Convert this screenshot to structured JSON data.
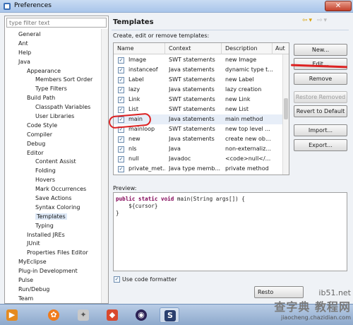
{
  "window": {
    "title": "Preferences"
  },
  "filter": {
    "placeholder": "type filter text"
  },
  "tree": [
    {
      "label": "General",
      "level": 0
    },
    {
      "label": "Ant",
      "level": 0
    },
    {
      "label": "Help",
      "level": 0
    },
    {
      "label": "Java",
      "level": 0
    },
    {
      "label": "Appearance",
      "level": 1
    },
    {
      "label": "Members Sort Order",
      "level": 2
    },
    {
      "label": "Type Filters",
      "level": 2
    },
    {
      "label": "Build Path",
      "level": 1
    },
    {
      "label": "Classpath Variables",
      "level": 2
    },
    {
      "label": "User Libraries",
      "level": 2
    },
    {
      "label": "Code Style",
      "level": 1
    },
    {
      "label": "Compiler",
      "level": 1
    },
    {
      "label": "Debug",
      "level": 1
    },
    {
      "label": "Editor",
      "level": 1
    },
    {
      "label": "Content Assist",
      "level": 2
    },
    {
      "label": "Folding",
      "level": 2
    },
    {
      "label": "Hovers",
      "level": 2
    },
    {
      "label": "Mark Occurrences",
      "level": 2
    },
    {
      "label": "Save Actions",
      "level": 2
    },
    {
      "label": "Syntax Coloring",
      "level": 2
    },
    {
      "label": "Templates",
      "level": 2,
      "selected": true
    },
    {
      "label": "Typing",
      "level": 2
    },
    {
      "label": "Installed JREs",
      "level": 1
    },
    {
      "label": "JUnit",
      "level": 1
    },
    {
      "label": "Properties Files Editor",
      "level": 1
    },
    {
      "label": "MyEclipse",
      "level": 0
    },
    {
      "label": "Plug-in Development",
      "level": 0
    },
    {
      "label": "Pulse",
      "level": 0
    },
    {
      "label": "Run/Debug",
      "level": 0
    },
    {
      "label": "Team",
      "level": 0
    }
  ],
  "templates": {
    "title": "Templates",
    "description": "Create, edit or remove templates:",
    "columns": [
      "Name",
      "Context",
      "Description",
      "Aut"
    ],
    "rows": [
      {
        "name": "Image",
        "context": "SWT statements",
        "description": "new Image"
      },
      {
        "name": "instanceof",
        "context": "Java statements",
        "description": "dynamic type t..."
      },
      {
        "name": "Label",
        "context": "SWT statements",
        "description": "new Label"
      },
      {
        "name": "lazy",
        "context": "Java statements",
        "description": "lazy creation"
      },
      {
        "name": "Link",
        "context": "SWT statements",
        "description": "new Link"
      },
      {
        "name": "List",
        "context": "SWT statements",
        "description": "new List"
      },
      {
        "name": "main",
        "context": "Java statements",
        "description": "main method",
        "selected": true
      },
      {
        "name": "mainloop",
        "context": "SWT statements",
        "description": "new top level ..."
      },
      {
        "name": "new",
        "context": "Java statements",
        "description": "create new ob..."
      },
      {
        "name": "nls",
        "context": "Java",
        "description": "non-externaliz..."
      },
      {
        "name": "null",
        "context": "Javadoc",
        "description": "<code>null</..."
      },
      {
        "name": "private_met...",
        "context": "Java type memb...",
        "description": "private method"
      }
    ],
    "buttons": {
      "new": "New...",
      "edit": "Edit...",
      "remove": "Remove",
      "restore_removed": "Restore Removed",
      "revert_to_default": "Revert to Default",
      "import": "Import...",
      "export": "Export..."
    },
    "preview_label": "Preview:",
    "preview_code": {
      "kw1": "public static void",
      "sig": " main(String args[]) {",
      "line2": "    ${cursor}",
      "line3": "}"
    },
    "use_code_formatter": "Use code formatter",
    "restore_defaults": "Resto"
  },
  "watermark": {
    "line1": "查字典 教程网",
    "line2": "jiaocheng.chazidian.com",
    "site": "ib51.net"
  },
  "colors": {
    "annotation": "#dd2222",
    "keyword": "#7f0055",
    "selection": "#dde8f6"
  }
}
